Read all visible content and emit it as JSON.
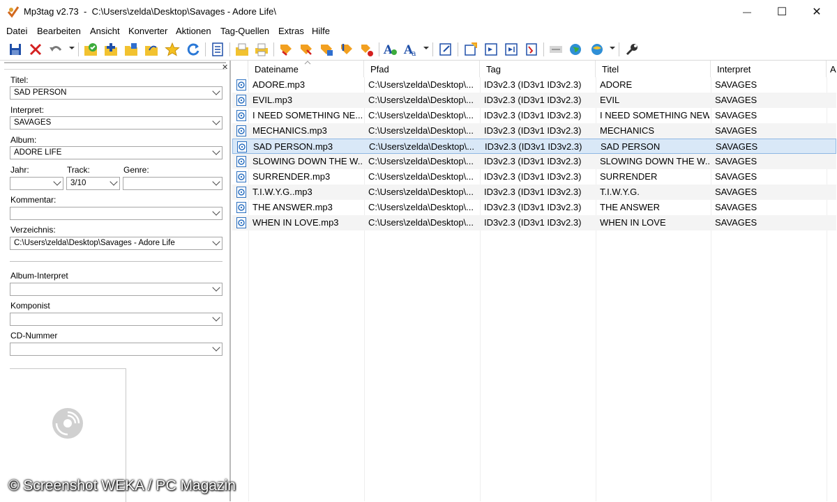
{
  "window": {
    "app_name": "Mp3tag v2.73",
    "path": "C:\\Users\\zelda\\Desktop\\Savages - Adore Life\\",
    "minimize": "—",
    "maximize": "☐",
    "close": "✕"
  },
  "menu": [
    "Datei",
    "Bearbeiten",
    "Ansicht",
    "Konverter",
    "Aktionen",
    "Tag-Quellen",
    "Extras",
    "Hilfe"
  ],
  "toolbar": {
    "icons": [
      "save-icon",
      "remove-tag-icon",
      "undo-icon",
      "save-green-icon",
      "add-file-icon",
      "add-folder-icon",
      "change-folder-icon",
      "favorite-star-icon",
      "refresh-icon",
      "list-view-icon",
      "export-icon",
      "print-icon",
      "tag-to-filename-icon",
      "filename-to-tag-icon",
      "text-to-tag-icon",
      "tag-to-tag-icon",
      "autonumber-icon",
      "case-convert-icon",
      "replace-text-icon",
      "extended-tags-icon",
      "playlist-icon",
      "playlist-import-icon",
      "playlist-export-icon",
      "filter-icon",
      "compare-icon",
      "web-source-icon",
      "web-source-menu-icon",
      "settings-wrench-icon"
    ]
  },
  "tag_panel": {
    "fields": {
      "titel": {
        "label": "Titel:",
        "value": "SAD PERSON"
      },
      "interpret": {
        "label": "Interpret:",
        "value": "SAVAGES"
      },
      "album": {
        "label": "Album:",
        "value": "ADORE LIFE"
      },
      "jahr": {
        "label": "Jahr:",
        "value": ""
      },
      "track": {
        "label": "Track:",
        "value": "3/10"
      },
      "genre": {
        "label": "Genre:",
        "value": ""
      },
      "kommentar": {
        "label": "Kommentar:",
        "value": ""
      },
      "verzeichnis": {
        "label": "Verzeichnis:",
        "value": "C:\\Users\\zelda\\Desktop\\Savages - Adore Life"
      },
      "album_interpret": {
        "label": "Album-Interpret",
        "value": ""
      },
      "komponist": {
        "label": "Komponist",
        "value": ""
      },
      "cd_nummer": {
        "label": "CD-Nummer",
        "value": ""
      }
    }
  },
  "file_list": {
    "columns": [
      "Dateiname",
      "Pfad",
      "Tag",
      "Titel",
      "Interpret",
      "A"
    ],
    "selected_index": 4,
    "rows": [
      [
        "ADORE.mp3",
        "C:\\Users\\zelda\\Desktop\\...",
        "ID3v2.3 (ID3v1 ID3v2.3)",
        "ADORE",
        "SAVAGES"
      ],
      [
        "EVIL.mp3",
        "C:\\Users\\zelda\\Desktop\\...",
        "ID3v2.3 (ID3v1 ID3v2.3)",
        "EVIL",
        "SAVAGES"
      ],
      [
        "I NEED SOMETHING NE...",
        "C:\\Users\\zelda\\Desktop\\...",
        "ID3v2.3 (ID3v1 ID3v2.3)",
        "I NEED SOMETHING NEW",
        "SAVAGES"
      ],
      [
        "MECHANICS.mp3",
        "C:\\Users\\zelda\\Desktop\\...",
        "ID3v2.3 (ID3v1 ID3v2.3)",
        "MECHANICS",
        "SAVAGES"
      ],
      [
        "SAD PERSON.mp3",
        "C:\\Users\\zelda\\Desktop\\...",
        "ID3v2.3 (ID3v1 ID3v2.3)",
        "SAD PERSON",
        "SAVAGES"
      ],
      [
        "SLOWING DOWN THE W...",
        "C:\\Users\\zelda\\Desktop\\...",
        "ID3v2.3 (ID3v1 ID3v2.3)",
        "SLOWING DOWN THE W...",
        "SAVAGES"
      ],
      [
        "SURRENDER.mp3",
        "C:\\Users\\zelda\\Desktop\\...",
        "ID3v2.3 (ID3v1 ID3v2.3)",
        "SURRENDER",
        "SAVAGES"
      ],
      [
        "T.I.W.Y.G..mp3",
        "C:\\Users\\zelda\\Desktop\\...",
        "ID3v2.3 (ID3v1 ID3v2.3)",
        "T.I.W.Y.G.",
        "SAVAGES"
      ],
      [
        "THE ANSWER.mp3",
        "C:\\Users\\zelda\\Desktop\\...",
        "ID3v2.3 (ID3v1 ID3v2.3)",
        "THE ANSWER",
        "SAVAGES"
      ],
      [
        "WHEN IN LOVE.mp3",
        "C:\\Users\\zelda\\Desktop\\...",
        "ID3v2.3 (ID3v1 ID3v2.3)",
        "WHEN IN LOVE",
        "SAVAGES"
      ]
    ]
  },
  "watermark": "© Screenshot WEKA / PC Magazin",
  "colors": {
    "selection": "#d9e8f7",
    "selection_border": "#8fb8e3",
    "alt_row": "#f4f4f4"
  }
}
